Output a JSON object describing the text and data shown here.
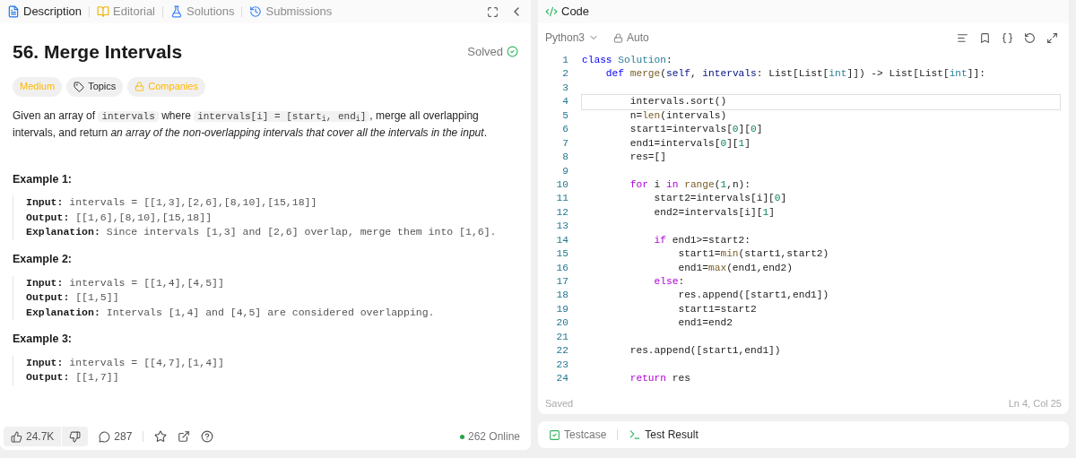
{
  "left_tabs": [
    {
      "label": "Description",
      "selected": true
    },
    {
      "label": "Editorial",
      "selected": false
    },
    {
      "label": "Solutions",
      "selected": false
    },
    {
      "label": "Submissions",
      "selected": false
    }
  ],
  "problem": {
    "title": "56. Merge Intervals",
    "status": "Solved",
    "solved": true,
    "tags": [
      {
        "label": "Medium",
        "kind": "difficulty"
      },
      {
        "label": "Topics",
        "kind": "topics"
      },
      {
        "label": "Companies",
        "kind": "companies"
      }
    ],
    "description": [
      {
        "text": "Given an array of ",
        "kind": "plain"
      },
      {
        "text": "intervals",
        "kind": "code"
      },
      {
        "text": " where ",
        "kind": "plain"
      },
      {
        "text": "intervals[i] = [start$_{i}$, end$_{i}$]",
        "kind": "code"
      },
      {
        "text": ", merge all overlapping intervals, and return ",
        "kind": "plain"
      },
      {
        "text": "an array of the non-overlapping intervals that cover all the intervals in the input",
        "kind": "italic"
      },
      {
        "text": ".",
        "kind": "plain"
      }
    ],
    "examples": [
      {
        "title": "Example 1:",
        "lines": [
          {
            "label": "Input:",
            "value": "intervals = [[1,3],[2,6],[8,10],[15,18]]"
          },
          {
            "label": "Output:",
            "value": "[[1,6],[8,10],[15,18]]"
          },
          {
            "label": "Explanation:",
            "value": "Since intervals [1,3] and [2,6] overlap, merge them into [1,6]."
          }
        ]
      },
      {
        "title": "Example 2:",
        "lines": [
          {
            "label": "Input:",
            "value": "intervals = [[1,4],[4,5]]"
          },
          {
            "label": "Output:",
            "value": "[[1,5]]"
          },
          {
            "label": "Explanation:",
            "value": "Intervals [1,4] and [4,5] are considered overlapping."
          }
        ]
      },
      {
        "title": "Example 3:",
        "lines": [
          {
            "label": "Input:",
            "value": "intervals = [[4,7],[1,4]]"
          },
          {
            "label": "Output:",
            "value": "[[1,7]]"
          }
        ]
      }
    ]
  },
  "footer": {
    "likes": "24.7K",
    "comments": "287",
    "online": "262 Online"
  },
  "editor": {
    "title": "Code",
    "language": "Python3",
    "mode": "Auto",
    "lines": [
      {
        "number": "1",
        "current": false,
        "tokens": [
          {
            "t": "class ",
            "kind": "kw"
          },
          {
            "t": "Solution",
            "kind": "type"
          },
          {
            "t": ":",
            "kind": "p"
          }
        ]
      },
      {
        "number": "2",
        "current": false,
        "tokens": [
          {
            "t": "    def ",
            "kind": "kw"
          },
          {
            "t": "merge",
            "kind": "fn"
          },
          {
            "t": "(",
            "kind": "p"
          },
          {
            "t": "self",
            "kind": "param"
          },
          {
            "t": ", ",
            "kind": "p"
          },
          {
            "t": "intervals",
            "kind": "param"
          },
          {
            "t": ": List[List[",
            "kind": "p"
          },
          {
            "t": "int",
            "kind": "type"
          },
          {
            "t": "]]) -> List[List[",
            "kind": "p"
          },
          {
            "t": "int",
            "kind": "type"
          },
          {
            "t": "]]:",
            "kind": "p"
          }
        ]
      },
      {
        "number": "3",
        "current": false
      },
      {
        "number": "4",
        "current": true,
        "tokens": [
          {
            "t": "        intervals.sort()",
            "kind": "p"
          }
        ]
      },
      {
        "number": "5",
        "current": false,
        "tokens": [
          {
            "t": "        n=",
            "kind": "p"
          },
          {
            "t": "len",
            "kind": "fn"
          },
          {
            "t": "(intervals)",
            "kind": "p"
          }
        ]
      },
      {
        "number": "6",
        "current": false,
        "tokens": [
          {
            "t": "        start1=intervals[",
            "kind": "p"
          },
          {
            "t": "0",
            "kind": "num"
          },
          {
            "t": "][",
            "kind": "p"
          },
          {
            "t": "0",
            "kind": "num"
          },
          {
            "t": "]",
            "kind": "p"
          }
        ]
      },
      {
        "number": "7",
        "current": false,
        "tokens": [
          {
            "t": "        end1=intervals[",
            "kind": "p"
          },
          {
            "t": "0",
            "kind": "num"
          },
          {
            "t": "][",
            "kind": "p"
          },
          {
            "t": "1",
            "kind": "num"
          },
          {
            "t": "]",
            "kind": "p"
          }
        ]
      },
      {
        "number": "8",
        "current": false,
        "tokens": [
          {
            "t": "        res=[]",
            "kind": "p"
          }
        ]
      },
      {
        "number": "9",
        "current": false
      },
      {
        "number": "10",
        "current": false,
        "tokens": [
          {
            "t": "        for",
            "kind": "ctrl"
          },
          {
            "t": " i ",
            "kind": "p"
          },
          {
            "t": "in",
            "kind": "ctrl"
          },
          {
            "t": " range",
            "kind": "fn"
          },
          {
            "t": "(",
            "kind": "p"
          },
          {
            "t": "1",
            "kind": "num"
          },
          {
            "t": ",n):",
            "kind": "p"
          }
        ]
      },
      {
        "number": "11",
        "current": false,
        "tokens": [
          {
            "t": "            start2=intervals[i][",
            "kind": "p"
          },
          {
            "t": "0",
            "kind": "num"
          },
          {
            "t": "]",
            "kind": "p"
          }
        ]
      },
      {
        "number": "12",
        "current": false,
        "tokens": [
          {
            "t": "            end2=intervals[i][",
            "kind": "p"
          },
          {
            "t": "1",
            "kind": "num"
          },
          {
            "t": "]",
            "kind": "p"
          }
        ]
      },
      {
        "number": "13",
        "current": false
      },
      {
        "number": "14",
        "current": false,
        "tokens": [
          {
            "t": "            if",
            "kind": "ctrl"
          },
          {
            "t": " end1>=start2:",
            "kind": "p"
          }
        ]
      },
      {
        "number": "15",
        "current": false,
        "tokens": [
          {
            "t": "                start1=",
            "kind": "p"
          },
          {
            "t": "min",
            "kind": "fn"
          },
          {
            "t": "(start1,start2)",
            "kind": "p"
          }
        ]
      },
      {
        "number": "16",
        "current": false,
        "tokens": [
          {
            "t": "                end1=",
            "kind": "p"
          },
          {
            "t": "max",
            "kind": "fn"
          },
          {
            "t": "(end1,end2)",
            "kind": "p"
          }
        ]
      },
      {
        "number": "17",
        "current": false,
        "tokens": [
          {
            "t": "            else",
            "kind": "ctrl"
          },
          {
            "t": ":",
            "kind": "p"
          }
        ]
      },
      {
        "number": "18",
        "current": false,
        "tokens": [
          {
            "t": "                res.append([start1,end1])",
            "kind": "p"
          }
        ]
      },
      {
        "number": "19",
        "current": false,
        "tokens": [
          {
            "t": "                start1=start2",
            "kind": "p"
          }
        ]
      },
      {
        "number": "20",
        "current": false,
        "tokens": [
          {
            "t": "                end1=end2",
            "kind": "p"
          }
        ]
      },
      {
        "number": "21",
        "current": false
      },
      {
        "number": "22",
        "current": false,
        "tokens": [
          {
            "t": "        res.append([start1,end1])",
            "kind": "p"
          }
        ]
      },
      {
        "number": "23",
        "current": false
      },
      {
        "number": "24",
        "current": false,
        "tokens": [
          {
            "t": "        return",
            "kind": "ctrl"
          },
          {
            "t": " res",
            "kind": "p"
          }
        ]
      }
    ],
    "save_status": "Saved",
    "cursor": "Ln 4, Col 25"
  },
  "bottom_tabs": [
    {
      "label": "Testcase"
    },
    {
      "label": "Test Result"
    }
  ]
}
